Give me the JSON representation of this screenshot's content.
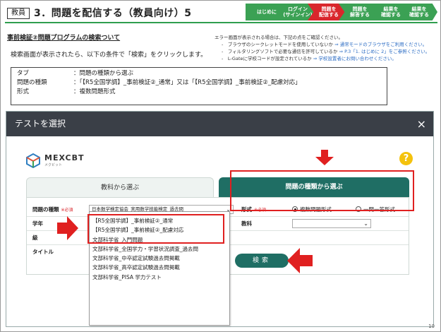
{
  "header": {
    "badge": "教員",
    "title": "3．問題を配信する（教員向け）5",
    "steps": [
      {
        "label": "はじめに",
        "color": "green"
      },
      {
        "label": "ログイン\n(サインイン)",
        "color": "green"
      },
      {
        "label": "問題を\n配信する",
        "color": "red"
      },
      {
        "label": "問題を\n解答する",
        "color": "green"
      },
      {
        "label": "結果を\n確認する",
        "color": "green"
      },
      {
        "label": "結果を\n確認する",
        "color": "green"
      }
    ]
  },
  "section_title": "事前検証②問題プログラムの検索ついて",
  "instruction": "検索画面が表示されたら、以下の条件で「検索」をクリックします。",
  "note": {
    "heading": "エラー画面が表示される場合は、下記の点をご確認ください。",
    "items": [
      {
        "prefix": "-　ブラウザのシークレットモードを使用していないか",
        "link": "⇒ 通常モードのブラウザをご利用ください。"
      },
      {
        "prefix": "-　フィルタリングソフトで必要な通信を許可しているか",
        "link": "⇒ P.3「1. はじめに 2」をご参照ください。"
      },
      {
        "prefix": "-　L-Gateに学校コードが設定されているか",
        "link": "⇒ 学校設置者にお問い合わせください。"
      }
    ]
  },
  "conditions": [
    {
      "key": "タブ",
      "value": "：問題の種類から選ぶ"
    },
    {
      "key": "問題の種類",
      "value": "：「【R5全国学調】_事前検証②_通常」又は「【R5全国学調】_事前検証②_配慮対応」"
    },
    {
      "key": "形式",
      "value": "：複数問題形式"
    }
  ],
  "dialog": {
    "title": "テストを選択",
    "close": "×",
    "logo_text": "MEXCBT",
    "logo_sub": "メクビット",
    "help": "?",
    "tab_subject": "教科から選ぶ",
    "tab_type": "問題の種類から選ぶ",
    "field_type_label": "問題の種類",
    "required_mark": "※必須",
    "field_type_value": "日本数学検定協会_実用数学技能検定_過去問",
    "field_year_label": "学年",
    "field_grade_label": "級",
    "field_title_label": "タイトル",
    "field_format_label": "形式",
    "format_opt1": "複数問題形式",
    "format_opt2": "一問一答形式",
    "field_subject_label": "教科",
    "dropdown_items": [
      "【R5全国学調】_事前検証②_通常",
      "【R5全国学調】_事前検証②_配慮対応",
      "文部科学省_入門問題",
      "文部科学省_全国学力・学習状況調査_過去問",
      "文部科学省_中卒認定試験過去問掲載",
      "文部科学省_高卒認定試験過去問掲載",
      "文部科学省_PISA 学力テスト"
    ],
    "search_button": "検索"
  },
  "page_number": "10",
  "colors": {
    "green": "#3ba154",
    "red": "#d9262c",
    "teal": "#1f6e64",
    "highlight": "#e02020"
  }
}
